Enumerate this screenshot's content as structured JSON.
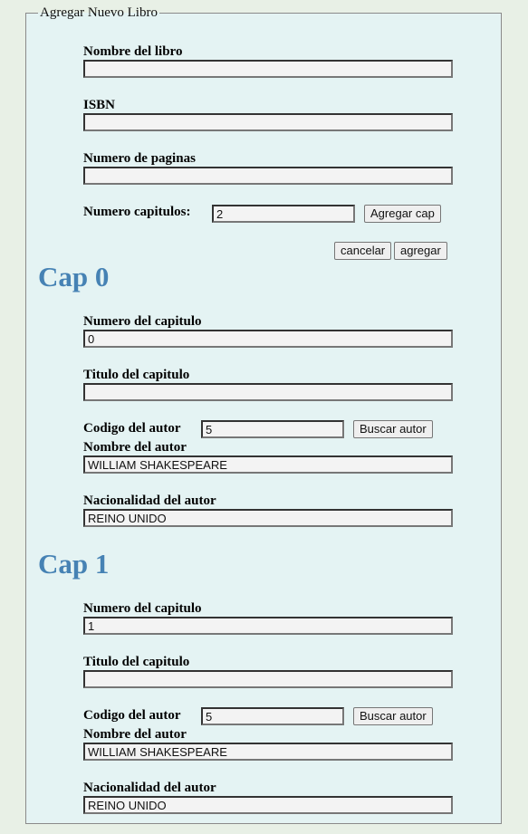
{
  "form": {
    "legend": "Agregar Nuevo Libro",
    "book_name_label": "Nombre del libro",
    "book_name_value": "",
    "isbn_label": "ISBN",
    "isbn_value": "",
    "pages_label": "Numero de paginas",
    "pages_value": "",
    "chapters_label": "Numero capitulos:",
    "chapters_value": "2",
    "add_chapter_button": "Agregar cap",
    "cancel_button": "cancelar",
    "add_button": "agregar"
  },
  "chapters": [
    {
      "title": "Cap 0",
      "number_label": "Numero del capitulo",
      "number_value": "0",
      "chapter_title_label": "Titulo del capitulo",
      "chapter_title_value": "",
      "author_code_label": "Codigo del autor",
      "author_code_value": "5",
      "search_author_button": "Buscar autor",
      "author_name_label": "Nombre del autor",
      "author_name_value": "WILLIAM SHAKESPEARE",
      "author_nationality_label": "Nacionalidad del autor",
      "author_nationality_value": "REINO UNIDO"
    },
    {
      "title": "Cap 1",
      "number_label": "Numero del capitulo",
      "number_value": "1",
      "chapter_title_label": "Titulo del capitulo",
      "chapter_title_value": "",
      "author_code_label": "Codigo del autor",
      "author_code_value": "5",
      "search_author_button": "Buscar autor",
      "author_name_label": "Nombre del autor",
      "author_name_value": "WILLIAM SHAKESPEARE",
      "author_nationality_label": "Nacionalidad del autor",
      "author_nationality_value": "REINO UNIDO"
    }
  ]
}
